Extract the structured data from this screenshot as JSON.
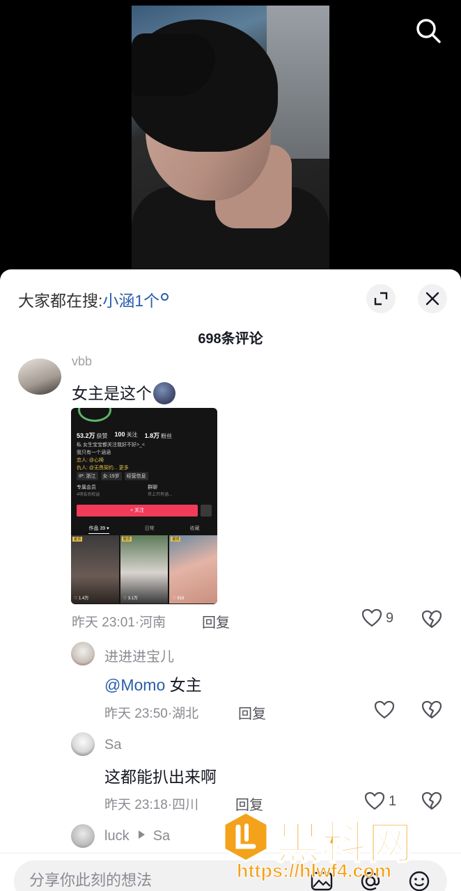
{
  "sheet": {
    "hot_search_prefix": "大家都在搜:",
    "hot_search_keyword": "小涵1个",
    "comment_count_title": "698条评论"
  },
  "comments": [
    {
      "user": "vbb",
      "text": "女主是这个",
      "time": "昨天 23:01·河南",
      "reply": "回复",
      "likes": "9",
      "image": {
        "stats": [
          {
            "num": "53.2万",
            "label": "获赞"
          },
          {
            "num": "100",
            "label": "关注"
          },
          {
            "num": "1.8万",
            "label": "粉丝"
          }
        ],
        "bio_lines": [
          "私 女生宝宝都关注我好不好>_<",
          "我只有一个涵涵",
          "恋人: @心椅",
          "仇人: @无畏契约... 更多"
        ],
        "tags": [
          "IP: 浙江",
          "女·19岁",
          "经营信息"
        ],
        "card1_title": "专属会员",
        "card1_sub": "4项会员权益",
        "card2_title": "群聊",
        "card2_sub": "世上只有涵...",
        "follow_label": "+ 关注",
        "tabs": [
          "作品 39 ▾",
          "日常",
          "收藏"
        ],
        "thumbs": [
          {
            "pin": "置顶",
            "count": "♡ 1.4万"
          },
          {
            "pin": "置顶",
            "count": "♡ 3.1万"
          },
          {
            "pin": "置顶",
            "count": "♡ 916"
          }
        ]
      }
    }
  ],
  "replies": [
    {
      "user": "进进进宝儿",
      "mention": "@Momo",
      "text": " 女主",
      "time": "昨天 23:50·湖北",
      "reply": "回复",
      "likes": ""
    },
    {
      "user": "Sa",
      "text": "这都能扒出来啊",
      "time": "昨天 23:18·四川",
      "reply": "回复",
      "likes": "1"
    },
    {
      "user_from": "luck",
      "user_to": "Sa"
    }
  ],
  "input": {
    "placeholder": "分享你此刻的想法"
  },
  "watermark": {
    "text": "黑料网",
    "url": "https://hlwf4.com"
  },
  "colors": {
    "link": "#2a5da8",
    "watermark": "#f4a21b",
    "follow": "#f03b5a"
  }
}
